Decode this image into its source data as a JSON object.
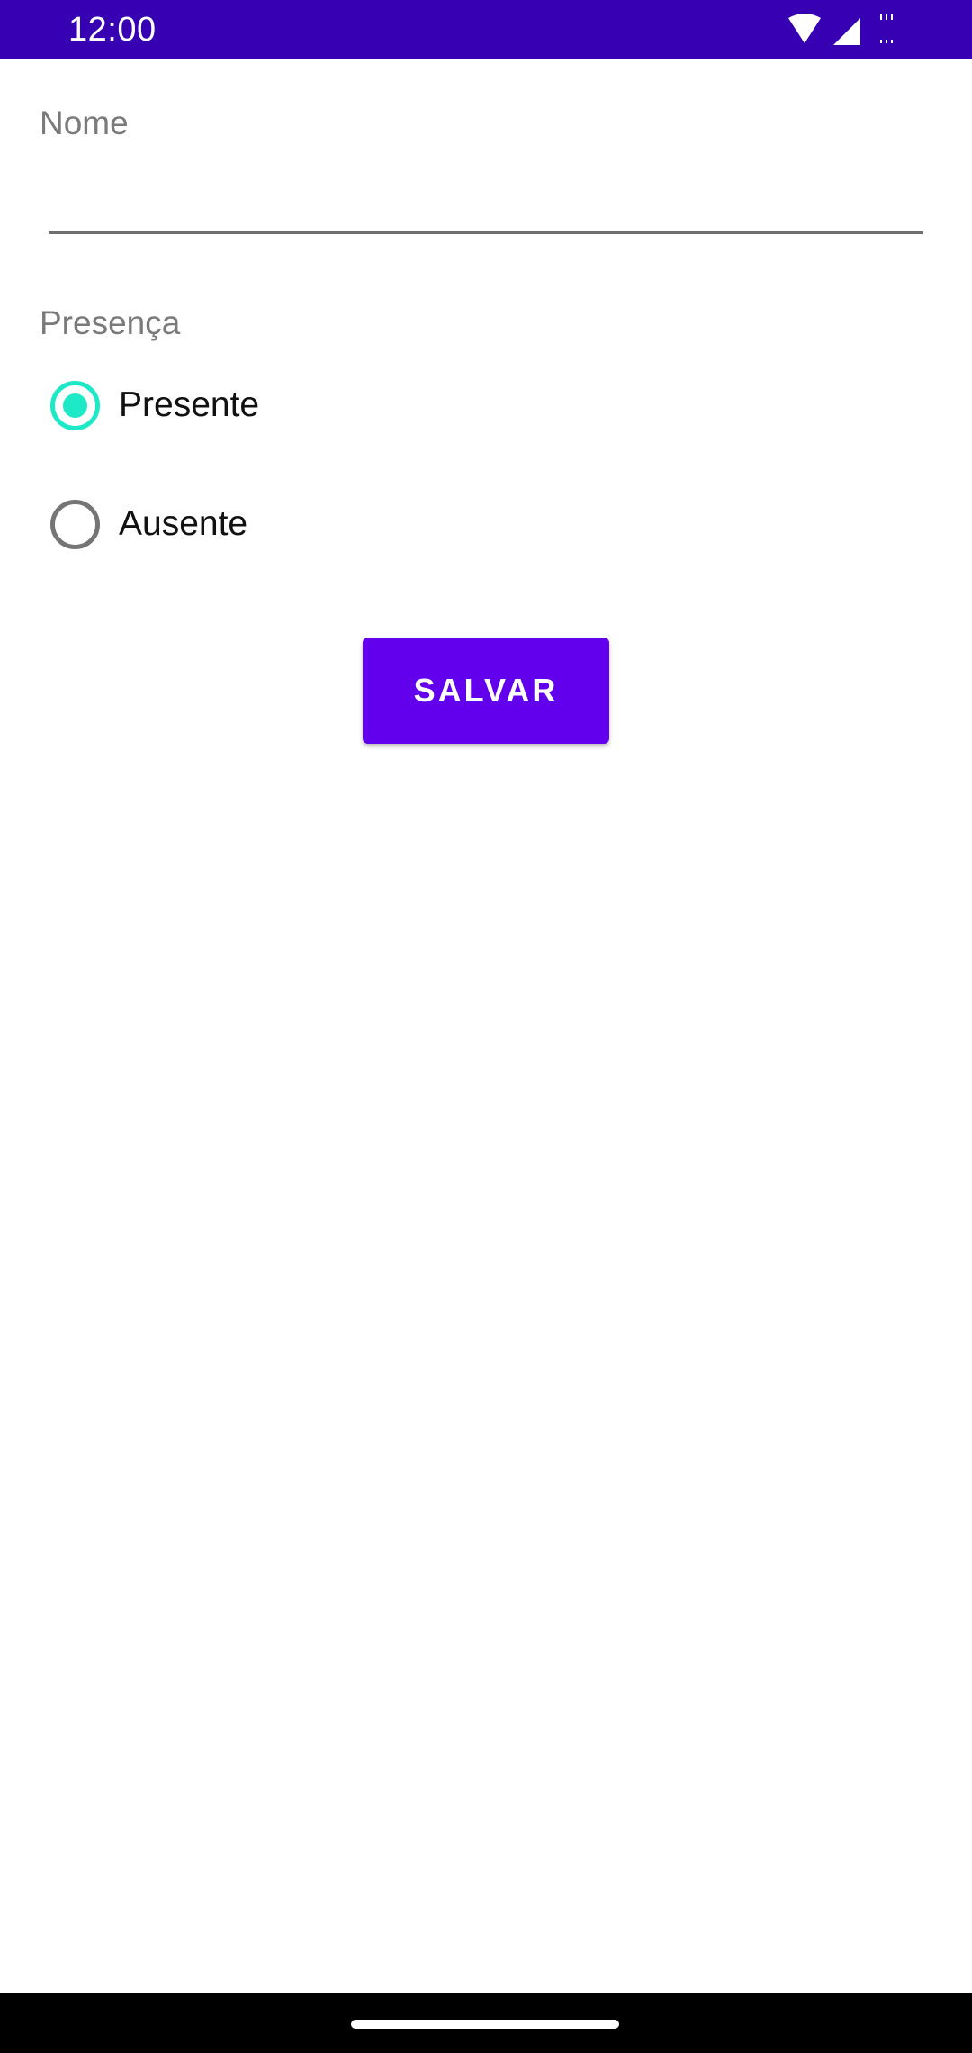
{
  "status_bar": {
    "time": "12:00",
    "background_color": "#3700b3",
    "icons": [
      "wifi-icon",
      "cellular-signal-icon",
      "data-activity-icon"
    ]
  },
  "form": {
    "nome_label": "Nome",
    "nome_value": "",
    "presenca_label": "Presença",
    "options": [
      {
        "label": "Presente",
        "selected": true
      },
      {
        "label": "Ausente",
        "selected": false
      }
    ],
    "accent_color": "#1de9c6"
  },
  "save_button": {
    "label": "SALVAR",
    "color": "#6200ee"
  }
}
